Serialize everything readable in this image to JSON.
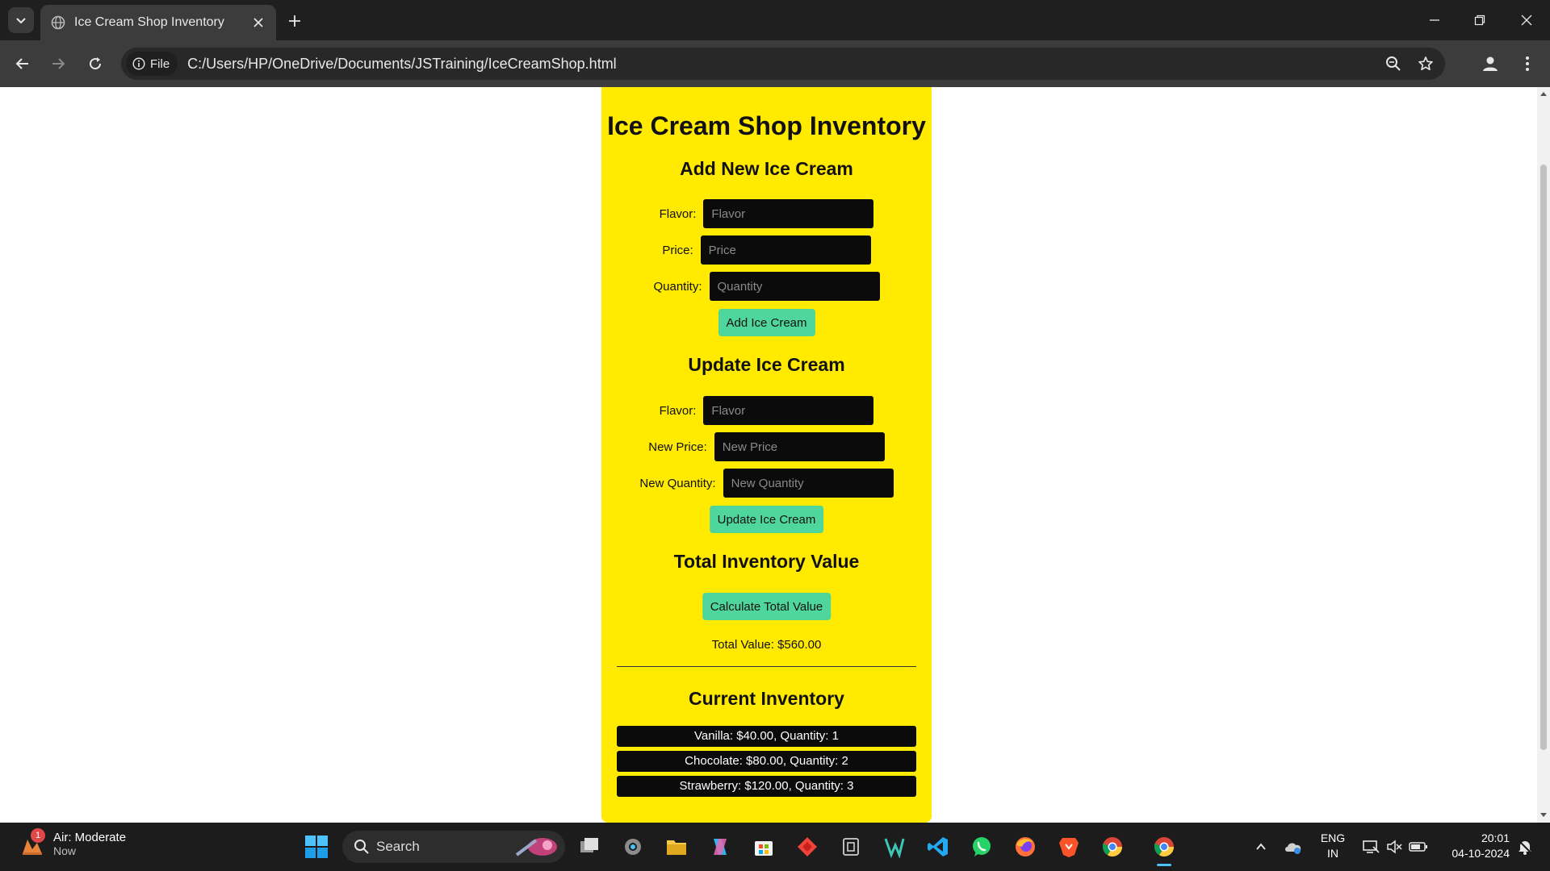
{
  "browser": {
    "tab_title": "Ice Cream Shop Inventory",
    "site_chip": "File",
    "url": "C:/Users/HP/OneDrive/Documents/JSTraining/IceCreamShop.html"
  },
  "page": {
    "title": "Ice Cream Shop Inventory",
    "add_section": {
      "title": "Add New Ice Cream",
      "flavor_label": "Flavor:",
      "flavor_placeholder": "Flavor",
      "price_label": "Price:",
      "price_placeholder": "Price",
      "quantity_label": "Quantity:",
      "quantity_placeholder": "Quantity",
      "button": "Add Ice Cream"
    },
    "update_section": {
      "title": "Update Ice Cream",
      "flavor_label": "Flavor:",
      "flavor_placeholder": "Flavor",
      "price_label": "New Price:",
      "price_placeholder": "New Price",
      "quantity_label": "New Quantity:",
      "quantity_placeholder": "New Quantity",
      "button": "Update Ice Cream"
    },
    "total_section": {
      "title": "Total Inventory Value",
      "button": "Calculate Total Value",
      "result": "Total Value: $560.00"
    },
    "inventory": {
      "title": "Current Inventory",
      "items": [
        "Vanilla: $40.00, Quantity: 1",
        "Chocolate: $80.00, Quantity: 2",
        "Strawberry: $120.00, Quantity: 3"
      ]
    },
    "colors": {
      "card": "#ffea00",
      "button": "#4fd69c",
      "input": "#0b0b0b"
    }
  },
  "taskbar": {
    "weather_badge": "1",
    "weather_title": "Air: Moderate",
    "weather_sub": "Now",
    "search_label": "Search",
    "lang_line1": "ENG",
    "lang_line2": "IN",
    "time": "20:01",
    "date": "04-10-2024",
    "apps": [
      "settings-icon",
      "file-explorer-icon",
      "copilot-icon",
      "microsoft-store-icon",
      "anydesk-icon",
      "notepad-icon",
      "visual-studio-icon",
      "vscode-icon",
      "whatsapp-icon",
      "firefox-icon",
      "brave-icon",
      "chrome-icon",
      "chrome-active-icon"
    ]
  }
}
